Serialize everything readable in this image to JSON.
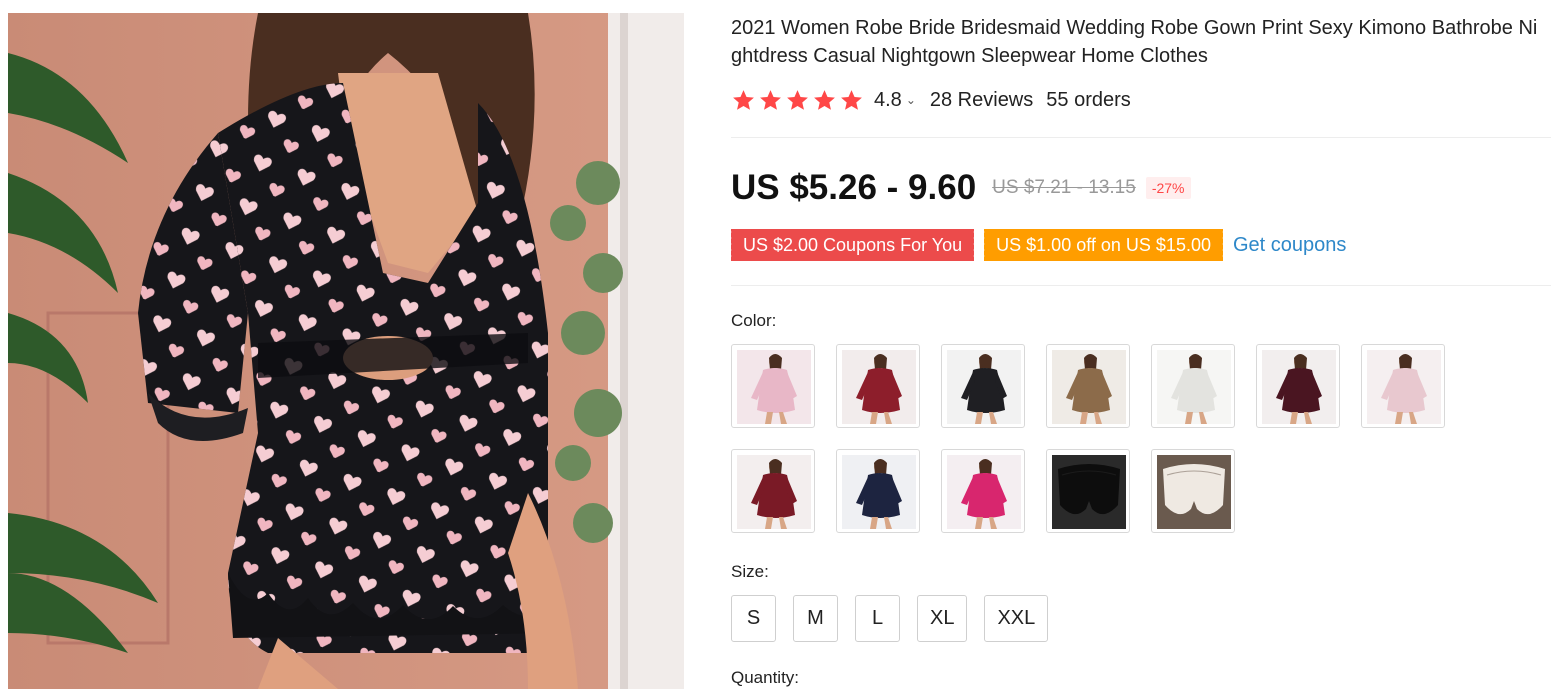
{
  "product": {
    "title": "2021 Women Robe Bride Bridesmaid Wedding Robe Gown Print Sexy Kimono Bathrobe Nightdress Casual Nightgown Sleepwear Home Clothes",
    "rating_stars": 5,
    "rating_value": "4.8",
    "reviews": "28 Reviews",
    "orders": "55 orders"
  },
  "price": {
    "current": "US $5.26 - 9.60",
    "original": "US $7.21 - 13.15",
    "discount": "-27%"
  },
  "coupons": {
    "store_coupon": "US $2.00 Coupons For You",
    "select_coupon": "US $1.00 off on US $15.00",
    "get_coupons": "Get coupons"
  },
  "labels": {
    "color": "Color:",
    "size": "Size:",
    "quantity": "Quantity:"
  },
  "colors": {
    "swatches": [
      {
        "name": "floral-pink-robe",
        "bg": "#f3e6ea",
        "robe": "#e8b7c7"
      },
      {
        "name": "red-print-robe",
        "bg": "#f2ecec",
        "robe": "#8d1e2b"
      },
      {
        "name": "black-heart-robe",
        "bg": "#f2f2f2",
        "robe": "#1f1f23"
      },
      {
        "name": "leopard-robe",
        "bg": "#efebe6",
        "robe": "#8c6b4a"
      },
      {
        "name": "white-floral-robe",
        "bg": "#f6f6f4",
        "robe": "#e3e3df"
      },
      {
        "name": "burgundy-robe",
        "bg": "#f2eeee",
        "robe": "#4a1521"
      },
      {
        "name": "light-pink-robe",
        "bg": "#f5eff0",
        "robe": "#e8c8cf"
      },
      {
        "name": "wine-red-robe",
        "bg": "#f3eeee",
        "robe": "#7a1a26"
      },
      {
        "name": "navy-robe",
        "bg": "#eff0f3",
        "robe": "#1d2440"
      },
      {
        "name": "rose-red-robe",
        "bg": "#f4eef1",
        "robe": "#d8266e"
      },
      {
        "name": "black-lace-shorts",
        "bg": "#2a2a2a",
        "robe": "#0d0d0d"
      },
      {
        "name": "white-lace-shorts",
        "bg": "#6a5a4e",
        "robe": "#efe9e2"
      }
    ]
  },
  "sizes": [
    "S",
    "M",
    "L",
    "XL",
    "XXL"
  ],
  "theme": {
    "star_color": "#ff4747",
    "price_color": "#111111",
    "coupon_red": "#ec4b4b",
    "coupon_orange": "#ff9d00",
    "link_color": "#2e88c9"
  }
}
